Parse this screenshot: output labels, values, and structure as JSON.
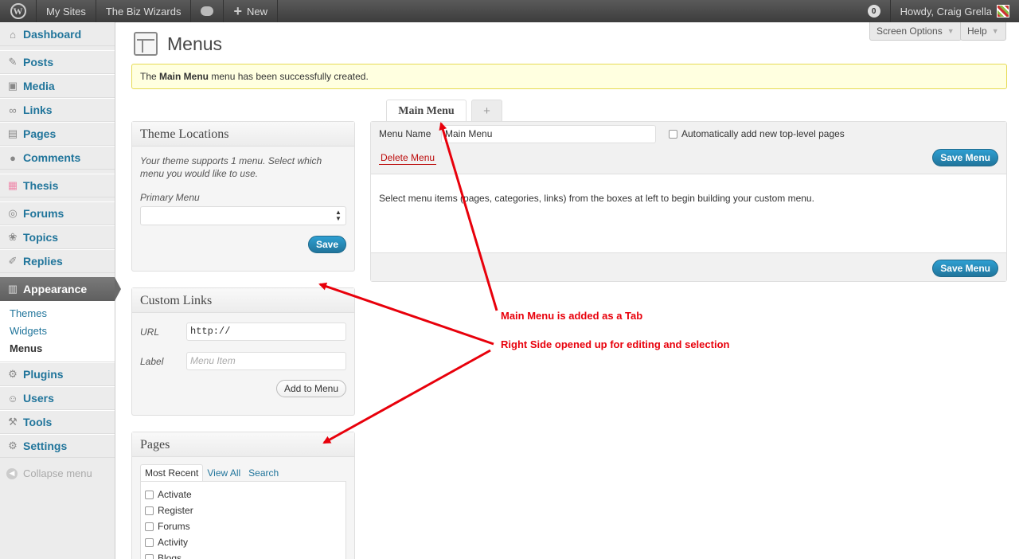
{
  "adminbar": {
    "my_sites": "My Sites",
    "site_name": "The Biz Wizards",
    "new_label": "New",
    "updates_count": "0",
    "howdy": "Howdy, Craig Grella"
  },
  "sidebar": {
    "dashboard": "Dashboard",
    "posts": "Posts",
    "media": "Media",
    "links": "Links",
    "pages": "Pages",
    "comments": "Comments",
    "thesis": "Thesis",
    "forums": "Forums",
    "topics": "Topics",
    "replies": "Replies",
    "appearance": "Appearance",
    "themes": "Themes",
    "widgets": "Widgets",
    "menus": "Menus",
    "plugins": "Plugins",
    "users": "Users",
    "tools": "Tools",
    "settings": "Settings",
    "collapse": "Collapse menu"
  },
  "header": {
    "title": "Menus",
    "screen_options": "Screen Options",
    "help": "Help"
  },
  "notice": {
    "prefix": "The ",
    "menu_name": "Main Menu",
    "suffix": " menu has been successfully created."
  },
  "theme_locations": {
    "title": "Theme Locations",
    "description": "Your theme supports 1 menu. Select which menu you would like to use.",
    "primary_label": "Primary Menu",
    "primary_value": "",
    "save": "Save"
  },
  "custom_links": {
    "title": "Custom Links",
    "url_label": "URL",
    "url_value": "http://",
    "label_label": "Label",
    "label_placeholder": "Menu Item",
    "add_button": "Add to Menu"
  },
  "pages_box": {
    "title": "Pages",
    "tabs": [
      "Most Recent",
      "View All",
      "Search"
    ],
    "items": [
      "Activate",
      "Register",
      "Forums",
      "Activity",
      "Blogs"
    ]
  },
  "editor": {
    "tab_name": "Main Menu",
    "add_tab": "+",
    "menu_name_label": "Menu Name",
    "menu_name_value": "Main Menu",
    "auto_add_label": "Automatically add new top-level pages",
    "delete": "Delete Menu",
    "save": "Save Menu",
    "instructions": "Select menu items (pages, categories, links) from the boxes at left to begin building your custom menu."
  },
  "annotations": {
    "note1": "Main Menu is added as a Tab",
    "note2": "Right Side opened up for editing and selection",
    "color": "#e8000b"
  }
}
